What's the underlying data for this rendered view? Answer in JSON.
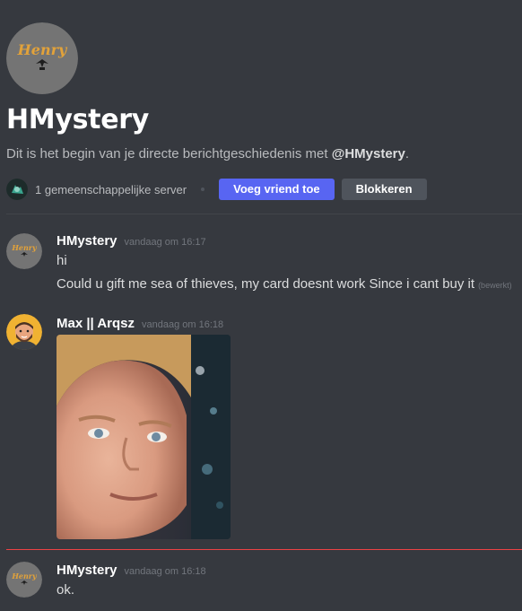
{
  "intro": {
    "avatar_text": "Henry",
    "title": "HMystery",
    "desc_prefix": "Dit is het begin van je directe berichtgeschiedenis met ",
    "desc_mention": "@HMystery",
    "desc_suffix": ".",
    "mutual_servers": "1 gemeenschappelijke server",
    "add_friend_label": "Voeg vriend toe",
    "block_label": "Blokkeren"
  },
  "messages": [
    {
      "author": "HMystery",
      "avatar_text": "Henry",
      "timestamp": "vandaag om 16:17",
      "lines": [
        "hi",
        "Could u gift me sea of thieves, my card doesnt work Since i cant buy it"
      ],
      "edited_label": "(bewerkt)"
    },
    {
      "author": "Max || Arqsz",
      "timestamp": "vandaag om 16:18",
      "attachment": "reaction-gif"
    },
    {
      "author": "HMystery",
      "avatar_text": "Henry",
      "timestamp": "vandaag om 16:18",
      "lines": [
        "ok."
      ]
    }
  ],
  "colors": {
    "background": "#36393f",
    "primary_button": "#5865f2",
    "secondary_button": "#4f545c",
    "new_messages_divider": "#ed4245"
  }
}
